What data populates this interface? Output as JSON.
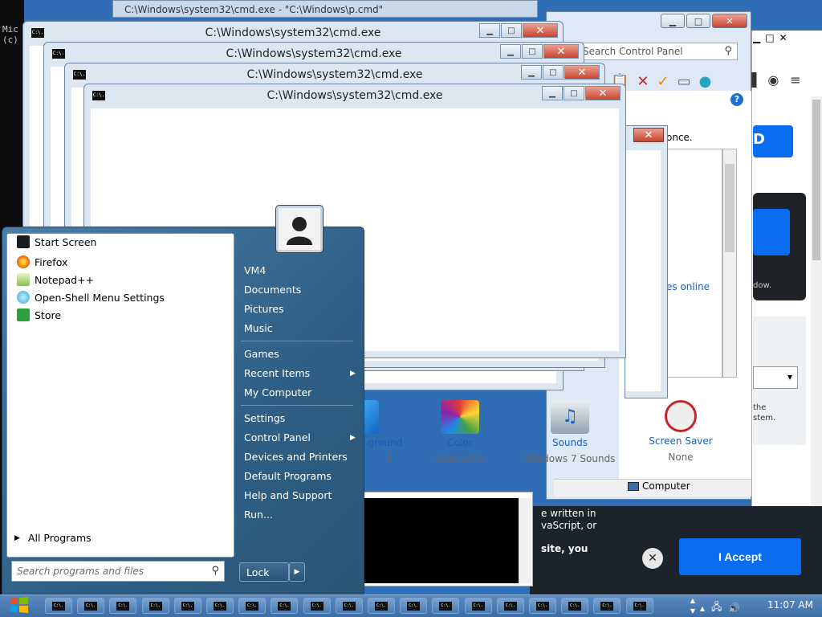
{
  "console_bg": {
    "lines": [
      "Mic",
      "(c)"
    ]
  },
  "top_strip": {
    "title": "C:\\Windows\\system32\\cmd.exe - \"C:\\Windows\\p.cmd\""
  },
  "cmd_windows": [
    {
      "title": "C:\\Windows\\system32\\cmd.exe"
    },
    {
      "title": "C:\\Windows\\system32\\cmd.exe"
    },
    {
      "title": "C:\\Windows\\system32\\cmd.exe"
    },
    {
      "title": "C:\\Windows\\system32\\cmd.exe"
    }
  ],
  "cmd_icon_text": "C:\\.",
  "window_buttons": {
    "minimize": "▁",
    "maximize": "□",
    "close": "✕"
  },
  "control_panel": {
    "search_placeholder": "Search Control Panel",
    "text_once": "once.",
    "link_online": "es online",
    "status_computer": "Computer",
    "help": "?"
  },
  "personalization": [
    {
      "label": "ground",
      "sub": "3"
    },
    {
      "label": "Color",
      "sub": "Automatic"
    },
    {
      "label": "Sounds",
      "sub": "Windows 7 Sounds"
    },
    {
      "label": "Screen Saver",
      "sub": "None"
    }
  ],
  "browser": {
    "blue_btn_text": "D",
    "dark_small": "dow.",
    "gray_text_1": "the",
    "gray_text_2": "stem.",
    "consent_text": "e written in\nvaScript, or",
    "consent_site": "site, you",
    "accept_label": "I Accept",
    "close_label": "✕"
  },
  "start_menu": {
    "left_items": [
      {
        "label": "Start Screen",
        "icon": "start-screen-icon",
        "color": "#1c1c1c"
      },
      {
        "label": "Firefox",
        "icon": "firefox-icon",
        "color": "#e66000"
      },
      {
        "label": "Notepad++",
        "icon": "notepad-plus-plus-icon",
        "color": "#8bc34a"
      },
      {
        "label": "Open-Shell Menu Settings",
        "icon": "open-shell-icon",
        "color": "#3aa7c9"
      },
      {
        "label": "Store",
        "icon": "store-icon",
        "color": "#2e9e3e"
      }
    ],
    "all_programs": "All Programs",
    "search_placeholder": "Search programs and files",
    "right_items": [
      {
        "label": "VM4"
      },
      {
        "label": "Documents"
      },
      {
        "label": "Pictures"
      },
      {
        "label": "Music"
      },
      {
        "label": "Games"
      },
      {
        "label": "Recent Items",
        "arrow": true
      },
      {
        "label": "My Computer"
      },
      {
        "label": "Settings"
      },
      {
        "label": "Control Panel",
        "arrow": true
      },
      {
        "label": "Devices and Printers"
      },
      {
        "label": "Default Programs"
      },
      {
        "label": "Help and Support"
      },
      {
        "label": "Run..."
      }
    ],
    "lock_label": "Lock"
  },
  "taskbar": {
    "clock": "11:07 AM",
    "item_count": 19
  }
}
